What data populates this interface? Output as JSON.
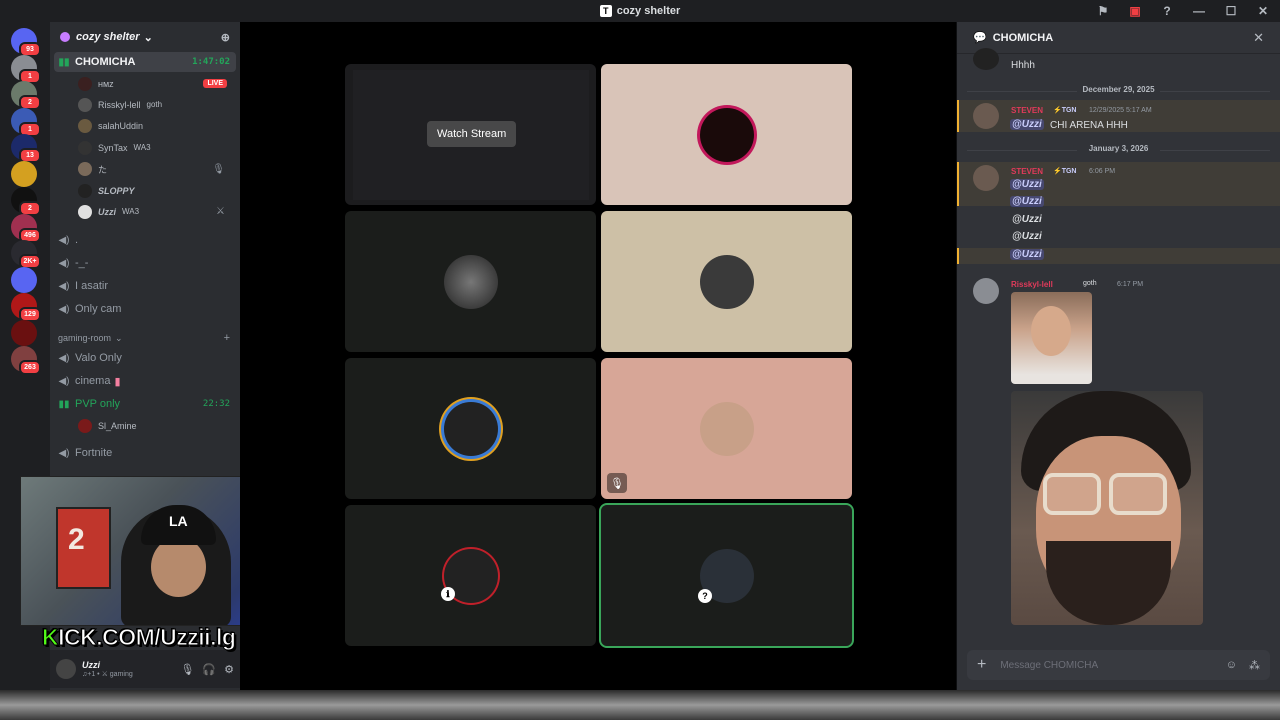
{
  "window": {
    "title": "cozy shelter",
    "logo_letter": "T",
    "controls": [
      "⚑",
      "▣",
      "?",
      "—",
      "☐",
      "✕"
    ]
  },
  "servers": [
    {
      "badge": "93",
      "color": "#5865f2"
    },
    {
      "badge": "1",
      "color": "#8a8d93"
    },
    {
      "badge": "2",
      "color": "#6b7a6b"
    },
    {
      "badge": "1",
      "color": "#3b5bb5"
    },
    {
      "badge": "13",
      "color": "#1c2a6a"
    },
    {
      "badge": "",
      "color": "#d4a020"
    },
    {
      "badge": "2",
      "color": "#111111"
    },
    {
      "badge": "496",
      "color": "#a03050"
    },
    {
      "badge": "2K+",
      "color": "#2a2a30"
    },
    {
      "badge": "",
      "color": "#5865f2"
    },
    {
      "badge": "129",
      "color": "#b01818"
    },
    {
      "badge": "",
      "color": "#6a1010"
    },
    {
      "badge": "263",
      "color": "#804040"
    }
  ],
  "server_header": {
    "name": "cozy shelter",
    "chevron": "⌄"
  },
  "channels": {
    "chomicha": {
      "name": "CHOMICHA",
      "timer": "1:47:02"
    },
    "users": [
      {
        "name": "ʜᴍᴢ",
        "tag": "",
        "live": "LIVE",
        "extra": ""
      },
      {
        "name": "Risskyl-lell",
        "tag": "goth",
        "live": "",
        "extra": ""
      },
      {
        "name": "salahUddin",
        "tag": "",
        "live": "",
        "extra": ""
      },
      {
        "name": "SynTax",
        "tag": "WA3",
        "live": "",
        "extra": ""
      },
      {
        "name": "た",
        "tag": "",
        "live": "",
        "extra": "🎙"
      },
      {
        "name": "SLOPPY",
        "tag": "",
        "live": "",
        "extra": ""
      },
      {
        "name": "Uzzi",
        "tag": "WA3",
        "live": "",
        "extra": "⚔"
      }
    ],
    "voice_list_1": [
      ".",
      "-_-",
      "I asatir",
      "Only cam"
    ],
    "category": {
      "name": "gaming-room",
      "plus": "+"
    },
    "voice_list_2": [
      "Valo Only",
      "cinema"
    ],
    "pvp": {
      "name": "PVP only",
      "timer": "22:32"
    },
    "pvp_user": "Sl_Amine",
    "fortnite": "Fortnite"
  },
  "user_panel": {
    "name": "Uzzi",
    "status": "♫+1 • ⚔ gaming"
  },
  "webcam": {
    "card_number": "2",
    "cap": "LA",
    "overlay_brand": "K",
    "overlay_text": "ICK.COM/Uzzii.lg"
  },
  "stage": {
    "watch_stream": "Watch Stream"
  },
  "chat": {
    "title": "CHOMICHA",
    "first_msg": "Hhhh",
    "date1": "December 29, 2025",
    "msg1": {
      "author": "STEVEN",
      "badge": "⚡TGN",
      "time": "12/29/2025 5:17 AM",
      "mention": "@Uzzi",
      "text": "CHI ARENA HHH"
    },
    "date2": "January 3, 2026",
    "msg2": {
      "author": "STEVEN",
      "badge": "⚡TGN",
      "time": "6:06 PM",
      "mentions": [
        "@Uzzi",
        "@Uzzi",
        "@Uzzi",
        "@Uzzi",
        "@Uzzi"
      ]
    },
    "msg3": {
      "author": "Risskyl-lell",
      "badge": "goth",
      "time": "6:17 PM"
    },
    "composer_placeholder": "Message CHOMICHA"
  },
  "colors": {
    "accent": "#5865f2",
    "green": "#23a55a",
    "live": "#f23f43",
    "author": "#e03a5a"
  }
}
